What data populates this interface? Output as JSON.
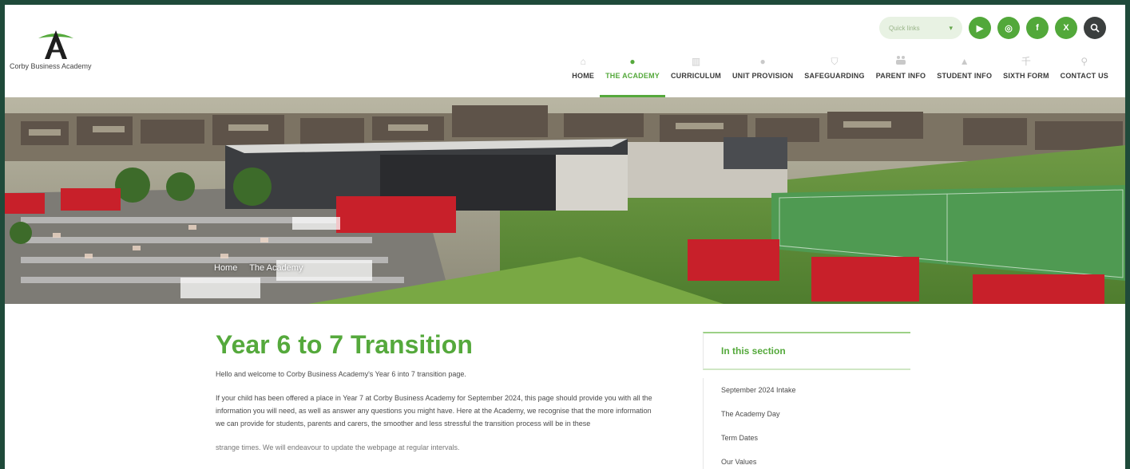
{
  "brand": {
    "name": "Corby Business Academy",
    "accent": "#55a93c",
    "dark": "#3b3f3e",
    "frame": "#1f4a3a"
  },
  "utility": {
    "quick_links": "Quick links",
    "social": [
      {
        "icon": "youtube-icon",
        "glyph": "▶"
      },
      {
        "icon": "instagram-icon",
        "glyph": "◎"
      },
      {
        "icon": "facebook-icon",
        "glyph": "f"
      },
      {
        "icon": "x-icon",
        "glyph": "X"
      }
    ],
    "search_icon": "search-icon"
  },
  "nav": [
    {
      "label": "HOME",
      "icon": "home-icon",
      "glyph": "⌂",
      "active": false
    },
    {
      "label": "THE ACADEMY",
      "icon": "speech-bubble-icon",
      "glyph": "●",
      "active": true
    },
    {
      "label": "CURRICULUM",
      "icon": "building-icon",
      "glyph": "▥",
      "active": false
    },
    {
      "label": "UNIT PROVISION",
      "icon": "circle-icon",
      "glyph": "●",
      "active": false
    },
    {
      "label": "SAFEGUARDING",
      "icon": "shield-icon",
      "glyph": "⛉",
      "active": false
    },
    {
      "label": "PARENT INFO",
      "icon": "people-icon",
      "glyph": "👪",
      "active": false
    },
    {
      "label": "STUDENT INFO",
      "icon": "person-icon",
      "glyph": "▲",
      "active": false
    },
    {
      "label": "SIXTH FORM",
      "icon": "signpost-icon",
      "glyph": "千",
      "active": false
    },
    {
      "label": "CONTACT US",
      "icon": "location-pin-icon",
      "glyph": "⚲",
      "active": false
    }
  ],
  "breadcrumb": [
    "Home",
    "The Academy"
  ],
  "main": {
    "title": "Year 6 to 7 Transition",
    "intro": "Hello and welcome to Corby Business Academy's Year 6 into 7 transition page.",
    "body": "If your child has been offered a place in Year 7 at Corby Business Academy for September 2024, this page should provide you with all the information you will need, as well as answer any questions you might have. Here at the Academy, we recognise that the more information we can provide for students, parents and carers, the smoother and less stressful the transition process will be in these",
    "cut_line": "strange times. We will endeavour to update the webpage at regular intervals."
  },
  "sidebar": {
    "heading": "In this section",
    "items": [
      "September 2024 Intake",
      "The Academy Day",
      "Term Dates",
      "Our Values"
    ]
  }
}
